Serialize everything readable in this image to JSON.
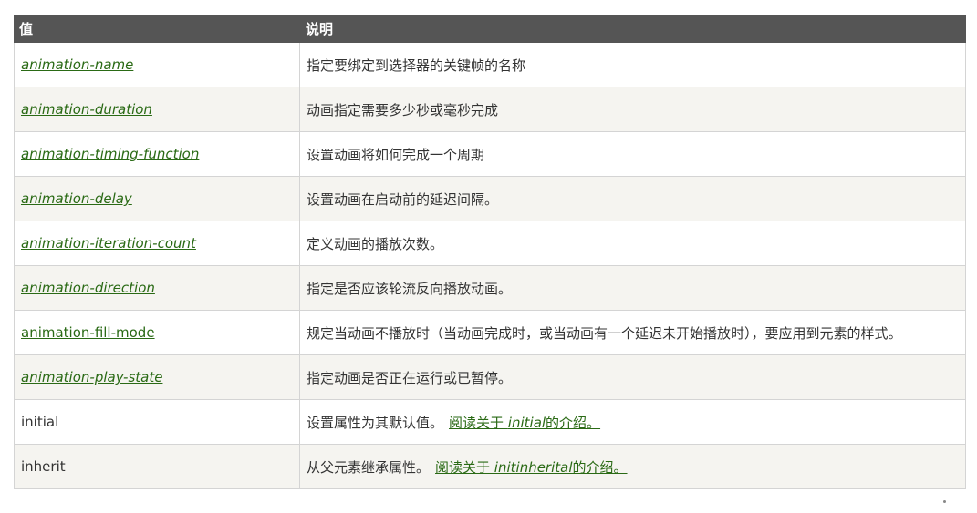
{
  "header": {
    "col_value": "值",
    "col_desc": "说明"
  },
  "rows": [
    {
      "value": "animation-name",
      "desc": "指定要绑定到选择器的关键帧的名称"
    },
    {
      "value": "animation-duration",
      "desc": "动画指定需要多少秒或毫秒完成"
    },
    {
      "value": "animation-timing-function",
      "desc": "设置动画将如何完成一个周期"
    },
    {
      "value": "animation-delay",
      "desc": "设置动画在启动前的延迟间隔。"
    },
    {
      "value": "animation-iteration-count",
      "desc": "定义动画的播放次数。"
    },
    {
      "value": "animation-direction",
      "desc": "指定是否应该轮流反向播放动画。"
    },
    {
      "value": "animation-fill-mode",
      "desc": "规定当动画不播放时（当动画完成时，或当动画有一个延迟未开始播放时），要应用到元素的样式。"
    },
    {
      "value": "animation-play-state",
      "desc": "指定动画是否正在运行或已暂停。"
    }
  ],
  "initial_row": {
    "value": "initial",
    "desc": "设置属性为其默认值。",
    "link_pre": "阅读关于 ",
    "link_em": "initial",
    "link_post": "的介绍。"
  },
  "inherit_row": {
    "value": "inherit",
    "desc": "从父元素继承属性。",
    "link_pre": "阅读关于 ",
    "link_em": "initinherital",
    "link_post": "的介绍。"
  }
}
